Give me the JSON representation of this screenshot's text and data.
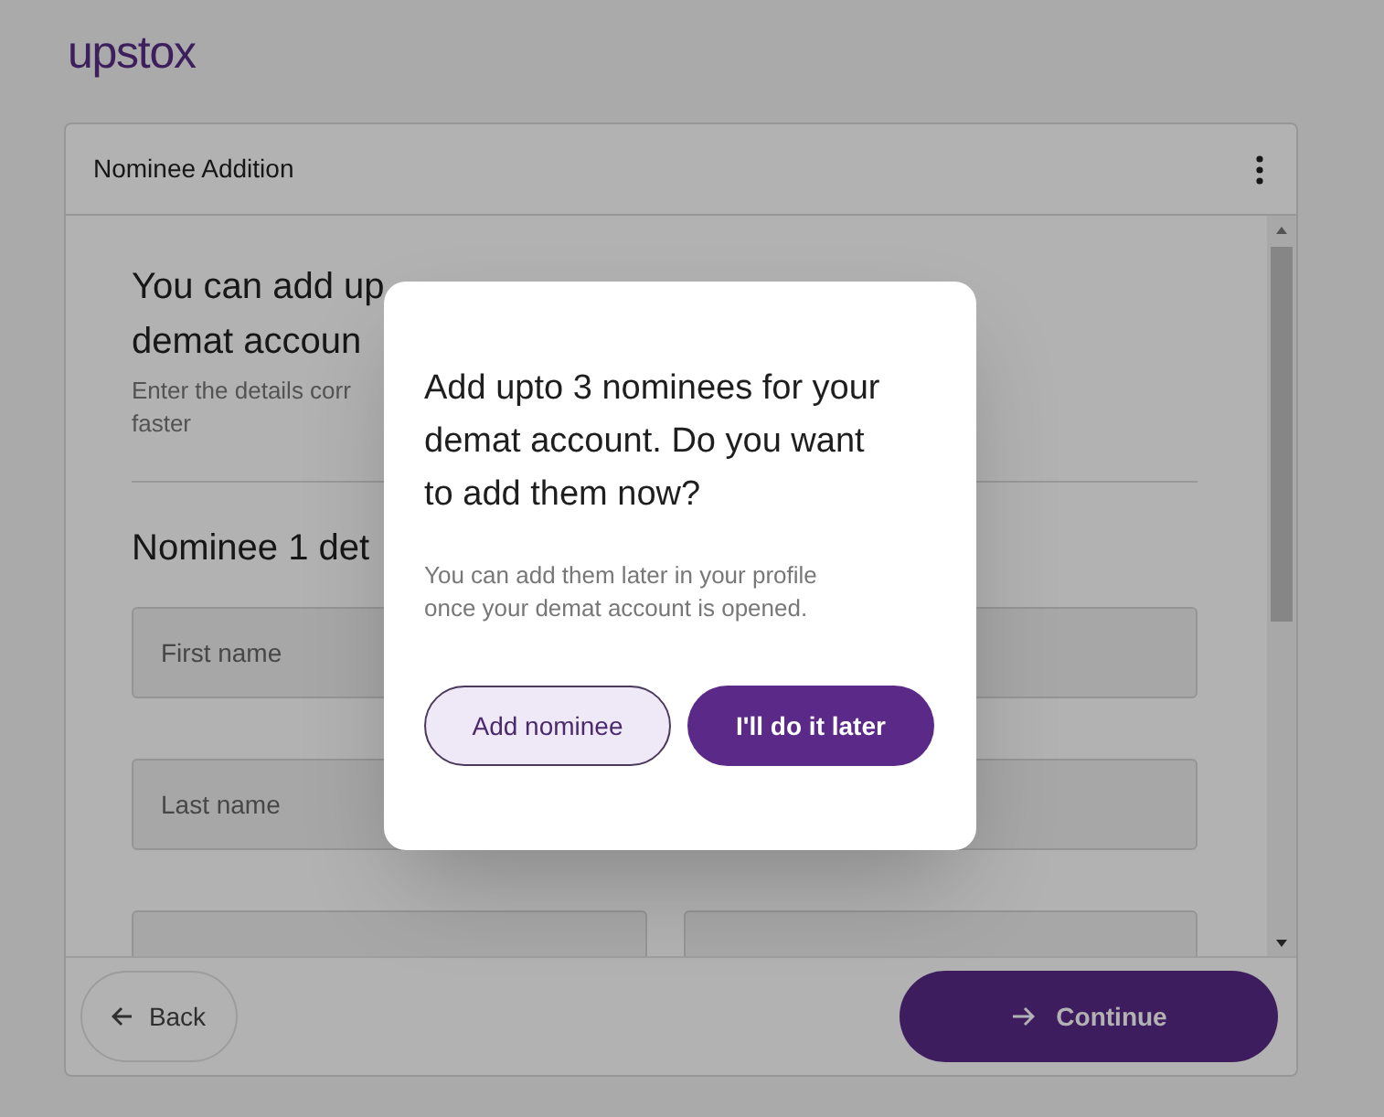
{
  "logo": {
    "text": "upstox"
  },
  "card": {
    "title": "Nominee Addition",
    "heading_lines": [
      "You can add up",
      "demat accoun"
    ],
    "description_lines": [
      "Enter the details corr",
      "faster"
    ],
    "section_title": "Nominee 1 det",
    "fields": [
      {
        "placeholder": "First name"
      },
      {
        "placeholder": "Last name"
      }
    ],
    "back": {
      "label": "Back"
    },
    "continue": {
      "label": "Continue"
    }
  },
  "modal": {
    "title": "Add upto 3 nominees for your demat account. Do you want to add them now?",
    "message": "You can add them later in your profile once your demat account is opened.",
    "buttons": [
      {
        "label": "Add nominee",
        "kind": "secondary"
      },
      {
        "label": "I'll do it later",
        "kind": "primary"
      }
    ]
  }
}
